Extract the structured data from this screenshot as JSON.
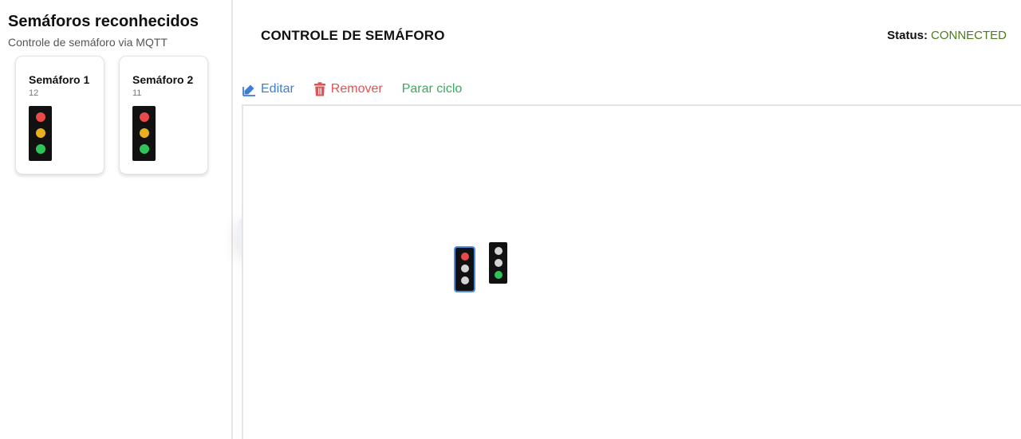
{
  "sidebar": {
    "title": "Semáforos reconhecidos",
    "subtitle": "Controle de semáforo via MQTT",
    "cards": [
      {
        "name": "Semáforo 1",
        "id": "12",
        "lamps": [
          "#e84a4a",
          "#e8b01e",
          "#2ec45a"
        ]
      },
      {
        "name": "Semáforo 2",
        "id": "11",
        "lamps": [
          "#e84a4a",
          "#e8b01e",
          "#2ec45a"
        ]
      }
    ]
  },
  "header": {
    "title": "CONTROLE DE SEMÁFORO",
    "status_label": "Status:",
    "status_value": "CONNECTED",
    "status_color": "#4c7a1c"
  },
  "toolbar": {
    "edit_label": "Editar",
    "remove_label": "Remover",
    "stop_label": "Parar ciclo",
    "edit_color": "#3d7fd6",
    "remove_color": "#e05353",
    "stop_color": "#3aaa5b"
  },
  "canvas": {
    "lights": [
      {
        "selected": true,
        "active_lamp": "red",
        "lamps": [
          "#e84a4a",
          "#d4d4d4",
          "#d4d4d4"
        ]
      },
      {
        "selected": false,
        "active_lamp": "green",
        "lamps": [
          "#d4d4d4",
          "#d4d4d4",
          "#2ec45a"
        ]
      }
    ]
  },
  "icons": {
    "collapse": "arrow-left-icon",
    "edit": "pencil-icon",
    "remove": "trash-icon"
  }
}
